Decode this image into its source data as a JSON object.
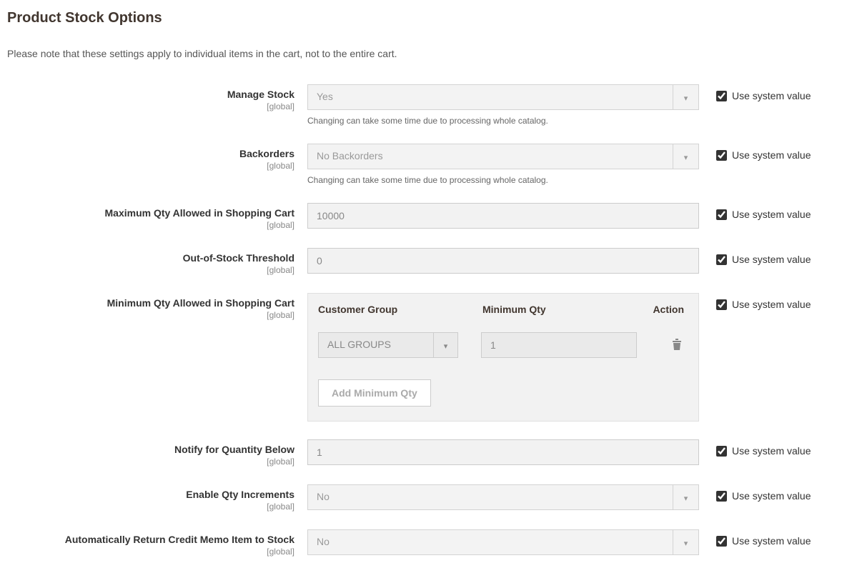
{
  "section_title": "Product Stock Options",
  "section_note": "Please note that these settings apply to individual items in the cart, not to the entire cart.",
  "scope_label": "[global]",
  "sys_value_label": "Use system value",
  "catalog_note": "Changing can take some time due to processing whole catalog.",
  "fields": {
    "manage_stock": {
      "label": "Manage Stock",
      "value": "Yes"
    },
    "backorders": {
      "label": "Backorders",
      "value": "No Backorders"
    },
    "max_qty": {
      "label": "Maximum Qty Allowed in Shopping Cart",
      "value": "10000"
    },
    "oos_threshold": {
      "label": "Out-of-Stock Threshold",
      "value": "0"
    },
    "min_qty": {
      "label": "Minimum Qty Allowed in Shopping Cart"
    },
    "notify_below": {
      "label": "Notify for Quantity Below",
      "value": "1"
    },
    "qty_increments": {
      "label": "Enable Qty Increments",
      "value": "No"
    },
    "auto_return": {
      "label": "Automatically Return Credit Memo Item to Stock",
      "value": "No"
    }
  },
  "min_qty_table": {
    "headers": {
      "group": "Customer Group",
      "qty": "Minimum Qty",
      "action": "Action"
    },
    "row": {
      "group": "ALL GROUPS",
      "qty": "1"
    },
    "add_button": "Add Minimum Qty"
  }
}
